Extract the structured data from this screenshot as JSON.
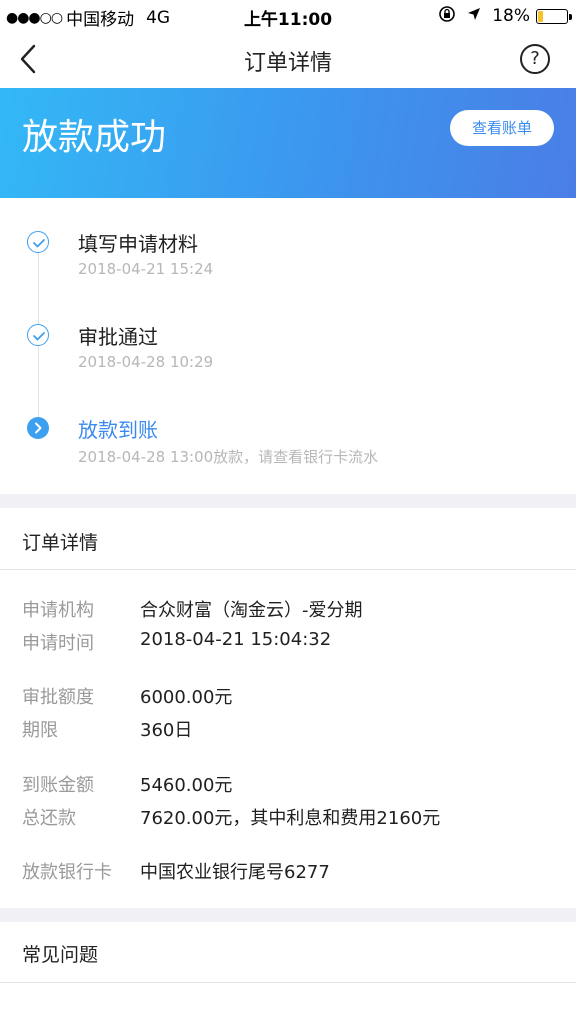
{
  "status_bar": {
    "signal": "●●●○○",
    "carrier": "中国移动",
    "network": "4G",
    "time": "上午11:00",
    "battery_percent": "18%",
    "battery_level": 0.18,
    "battery_color": "#f6c12b"
  },
  "nav": {
    "title": "订单详情",
    "help": "?"
  },
  "banner": {
    "title": "放款成功",
    "button": "查看账单",
    "accent": "#3a8df0"
  },
  "timeline": [
    {
      "title": "填写申请材料",
      "sub": "2018-04-21 15:24",
      "state": "done"
    },
    {
      "title": "审批通过",
      "sub": "2018-04-28 10:29",
      "state": "done"
    },
    {
      "title": "放款到账",
      "sub": "2018-04-28 13:00放款，请查看银行卡流水",
      "state": "active"
    }
  ],
  "details": {
    "heading": "订单详情",
    "rows": [
      {
        "key": "申请机构",
        "value": "合众财富（淘金云）-爱分期"
      },
      {
        "key": "申请时间",
        "value": "2018-04-21 15:04:32"
      },
      {
        "key": "审批额度",
        "value": "6000.00元"
      },
      {
        "key": "期限",
        "value": "360日"
      },
      {
        "key": "到账金额",
        "value": "5460.00元"
      },
      {
        "key": "总还款",
        "value": "7620.00元，其中利息和费用2160元"
      },
      {
        "key": "放款银行卡",
        "value": "中国农业银行尾号6277"
      }
    ]
  },
  "faq": {
    "title": "常见问题"
  }
}
